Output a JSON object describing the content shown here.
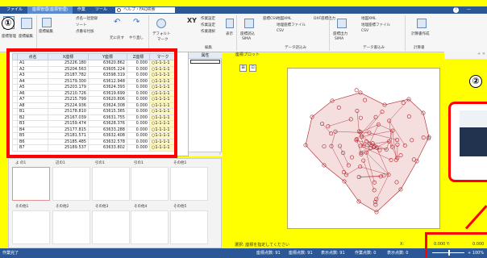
{
  "tabs": {
    "items": [
      "ファイル",
      "座標管理(座標管理)",
      "作業",
      "ツール"
    ],
    "help_placeholder": "ヘルプ・FAQ検索",
    "right_items": [
      "?",
      "—"
    ]
  },
  "ribbon": {
    "items": [
      {
        "label": "座標管理"
      },
      {
        "label": "座標編集"
      },
      {
        "label": "座標編集"
      },
      {
        "label": "点名一括登録"
      },
      {
        "label": "ソート"
      },
      {
        "label": "点番号付加"
      },
      {
        "label": "前に戻る"
      },
      {
        "label": "元に戻す"
      },
      {
        "label": "やり直し"
      },
      {
        "label": "デフォルト"
      },
      {
        "label": "マーク"
      },
      {
        "label": "XY"
      },
      {
        "label": "作業設定"
      },
      {
        "label": "作業設定"
      },
      {
        "label": "作業選択"
      },
      {
        "label": "表示"
      },
      {
        "label": "座標読込"
      },
      {
        "label": "SIMA"
      },
      {
        "label": "座標CSV"
      },
      {
        "label": "地図XML"
      },
      {
        "label": "地理座標ファイル"
      },
      {
        "label": "CSV"
      },
      {
        "label": "DXF座標出力"
      },
      {
        "label": "座標出力"
      },
      {
        "label": "SIMA"
      },
      {
        "label": "地図XML"
      },
      {
        "label": "地理座標ファイル"
      },
      {
        "label": "CSV"
      },
      {
        "label": "計算書作成"
      }
    ],
    "groups": [
      "編集",
      "データ読込み",
      "データ書込み",
      "計算書"
    ]
  },
  "badges": {
    "one": "①",
    "two": "②"
  },
  "table": {
    "headers": [
      "点名",
      "X座標",
      "Y座標",
      "Z座標",
      "マーク"
    ],
    "attr_header": "属性",
    "rows": [
      [
        "A1",
        "25226.180",
        "63620.862",
        "0.000",
        "○1-1-1-1"
      ],
      [
        "A2",
        "25204.563",
        "63605.224",
        "0.000",
        "○1-1-1-1"
      ],
      [
        "A3",
        "25187.782",
        "63598.319",
        "0.000",
        "○1-1-1-1"
      ],
      [
        "A4",
        "25179.300",
        "63612.948",
        "0.000",
        "○1-1-1-1"
      ],
      [
        "A5",
        "25203.179",
        "63624.393",
        "0.000",
        "○1-1-1-1"
      ],
      [
        "A6",
        "25210.726",
        "63619.699",
        "0.000",
        "○1-1-1-1"
      ],
      [
        "A7",
        "25215.799",
        "63620.806",
        "0.000",
        "○1-1-1-1"
      ],
      [
        "A8",
        "25224.936",
        "63624.308",
        "0.000",
        "○1-1-1-1"
      ],
      [
        "B1",
        "25178.810",
        "63615.365",
        "0.000",
        "○1-1-1-1"
      ],
      [
        "B2",
        "25167.039",
        "63631.755",
        "0.000",
        "○1-1-1-1"
      ],
      [
        "B3",
        "25159.474",
        "63628.376",
        "0.000",
        "○1-1-1-1"
      ],
      [
        "B4",
        "25177.815",
        "63633.288",
        "0.000",
        "○1-1-1-1"
      ],
      [
        "B5",
        "25181.571",
        "63632.408",
        "0.000",
        "○1-1-1-1"
      ],
      [
        "B6",
        "25185.485",
        "63632.578",
        "0.000",
        "○1-1-1-1"
      ],
      [
        "B7",
        "25189.537",
        "63633.802",
        "0.000",
        "○1-1-1-1"
      ]
    ]
  },
  "properties": {
    "row1": [
      "よ の1",
      "辺の1",
      "引の1",
      "引の1",
      "その他1"
    ],
    "row2": [
      "その他1",
      "その他2",
      "その他3",
      "その他4",
      "その他5"
    ]
  },
  "plot": {
    "title": "座標プロット",
    "message": "選択: 座標を指定してください",
    "x_label": "X:",
    "y_label": "0.000 Y:",
    "y_value": "0.000"
  },
  "right_panel": {
    "label": "+ ×"
  },
  "statusbar": {
    "left": "作業完了",
    "items": [
      "座標点数: 91",
      "座標点数: 91",
      "表示点数: 91",
      "作業点数: 0",
      "表示点数: 0"
    ],
    "zoom": "+ 100%"
  },
  "colors": {
    "accent_blue": "#2b5797",
    "highlight_yellow": "#ffff00",
    "callout_red": "#ff0000",
    "point_red": "#b0202a"
  }
}
